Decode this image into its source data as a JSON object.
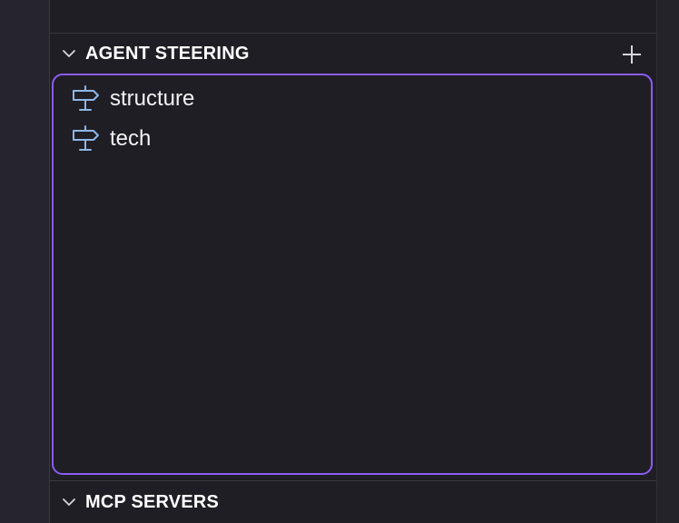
{
  "sections": {
    "steering": {
      "title": "AGENT STEERING",
      "items": [
        {
          "label": "structure",
          "icon": "signpost-icon"
        },
        {
          "label": "tech",
          "icon": "signpost-icon"
        }
      ]
    },
    "mcp": {
      "title": "MCP SERVERS"
    }
  },
  "colors": {
    "accent": "#8b5cf6",
    "icon": "#8fb6e8",
    "text": "#f2f2f5",
    "background": "#1f1e24"
  }
}
